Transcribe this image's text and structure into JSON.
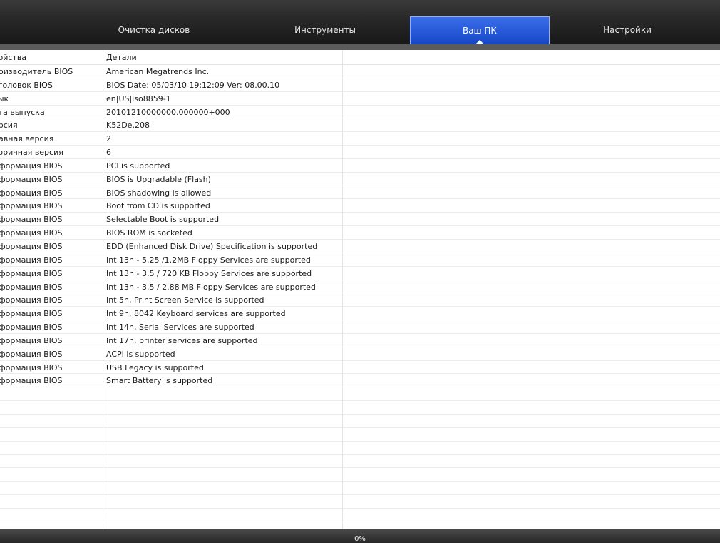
{
  "nav": {
    "tabs": [
      {
        "label": "Очистка дисков",
        "active": false
      },
      {
        "label": "Инструменты",
        "active": false
      },
      {
        "label": "Ваш ПК",
        "active": true
      },
      {
        "label": "Настройки",
        "active": false
      }
    ],
    "active_color": "#1f55dd"
  },
  "table": {
    "headers": {
      "property": "войства",
      "details": "Детали"
    },
    "rows": [
      {
        "property": "роизводитель BIOS",
        "details": "American Megatrends Inc."
      },
      {
        "property": "аголовок BIOS",
        "details": "BIOS Date: 05/03/10 19:12:09 Ver: 08.00.10"
      },
      {
        "property": "зык",
        "details": "en|US|iso8859-1"
      },
      {
        "property": "ата выпуска",
        "details": "20101210000000.000000+000"
      },
      {
        "property": "ерсия",
        "details": "K52De.208"
      },
      {
        "property": "лавная версия",
        "details": "2"
      },
      {
        "property": "торичная версия",
        "details": "6"
      },
      {
        "property": "нформация BIOS",
        "details": "PCI is supported"
      },
      {
        "property": "нформация BIOS",
        "details": "BIOS is Upgradable (Flash)"
      },
      {
        "property": "нформация BIOS",
        "details": "BIOS shadowing is allowed"
      },
      {
        "property": "нформация BIOS",
        "details": "Boot from CD is supported"
      },
      {
        "property": "нформация BIOS",
        "details": "Selectable Boot is supported"
      },
      {
        "property": "нформация BIOS",
        "details": "BIOS ROM is socketed"
      },
      {
        "property": "нформация BIOS",
        "details": "EDD (Enhanced Disk Drive) Specification is supported"
      },
      {
        "property": "нформация BIOS",
        "details": "Int 13h - 5.25 /1.2MB Floppy Services are supported"
      },
      {
        "property": "нформация BIOS",
        "details": "Int 13h - 3.5 / 720 KB Floppy Services are supported"
      },
      {
        "property": "нформация BIOS",
        "details": "Int 13h - 3.5 / 2.88 MB Floppy Services are supported"
      },
      {
        "property": "нформация BIOS",
        "details": "Int 5h, Print Screen Service is supported"
      },
      {
        "property": "нформация BIOS",
        "details": "Int 9h, 8042 Keyboard services are supported"
      },
      {
        "property": "нформация BIOS",
        "details": "Int 14h, Serial Services are supported"
      },
      {
        "property": "нформация BIOS",
        "details": "Int 17h, printer services are supported"
      },
      {
        "property": "нформация BIOS",
        "details": "ACPI is supported"
      },
      {
        "property": "нформация BIOS",
        "details": "USB Legacy is supported"
      },
      {
        "property": "нформация BIOS",
        "details": "Smart Battery is supported"
      }
    ]
  },
  "status": {
    "progress_label": "0%",
    "progress_value": 0
  }
}
